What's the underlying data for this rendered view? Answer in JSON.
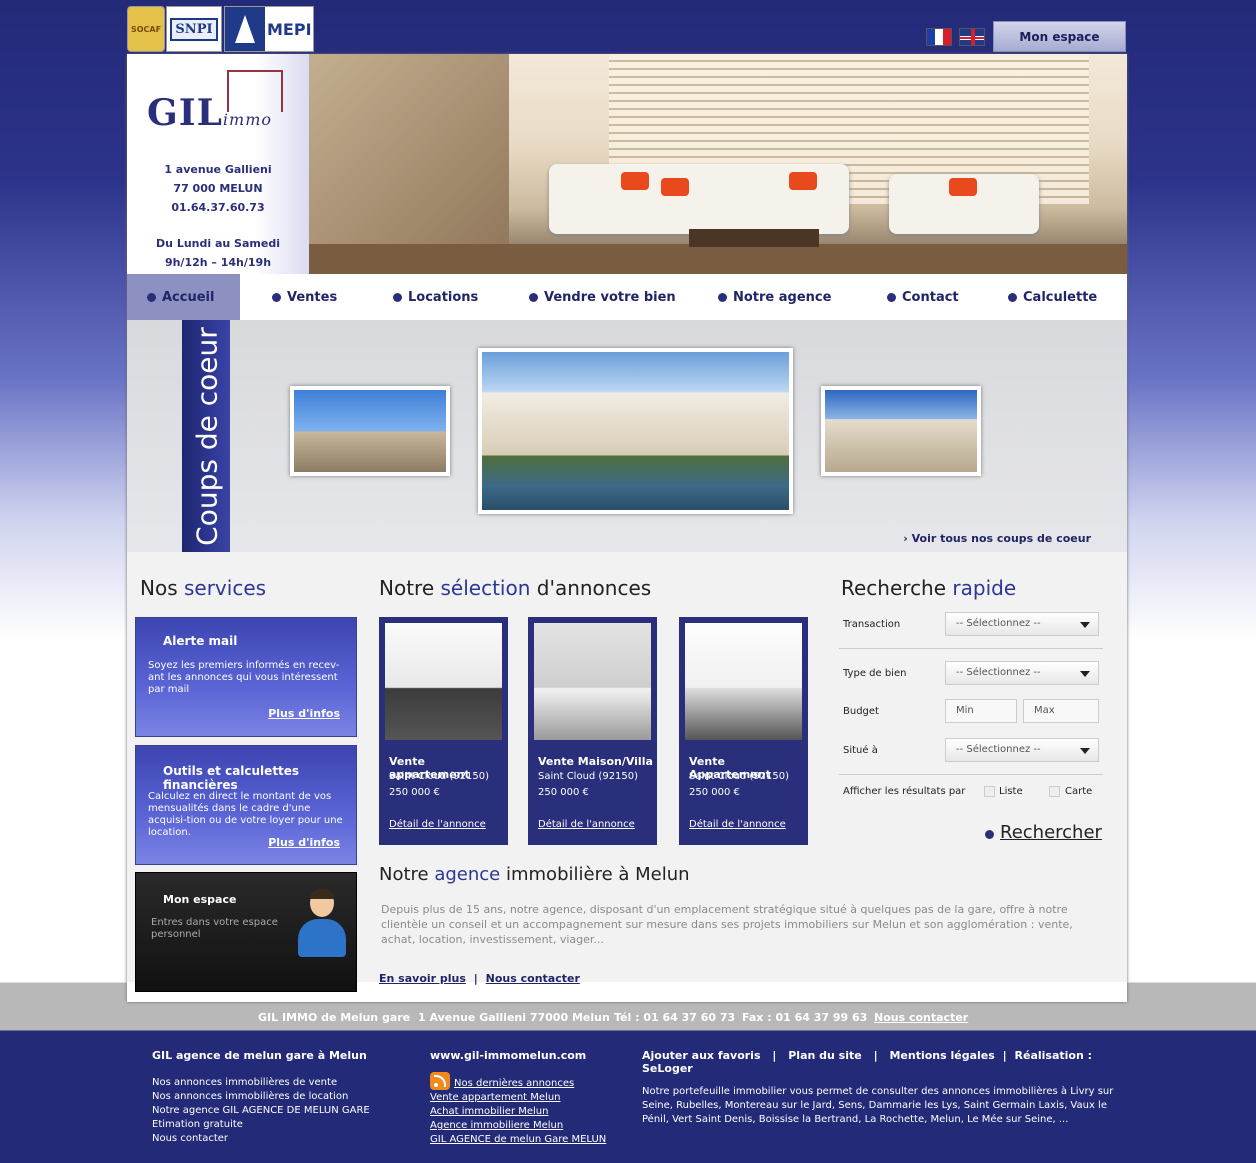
{
  "top": {
    "logos": {
      "socaf": "SOCAF",
      "snpi": "SNPI",
      "amepi": "MEPI"
    },
    "flags": [
      "fr",
      "uk"
    ],
    "mon_espace": "Mon espace"
  },
  "header": {
    "brand": "GIL",
    "brand_sub": "immo",
    "address1": "1 avenue Gallieni",
    "address2": "77 000 MELUN",
    "phone": "01.64.37.60.73",
    "hours1": "Du Lundi au Samedi",
    "hours2": "9h/12h – 14h/19h"
  },
  "nav": {
    "items": [
      {
        "label": "Accueil"
      },
      {
        "label": "Ventes"
      },
      {
        "label": "Locations"
      },
      {
        "label": "Vendre votre bien"
      },
      {
        "label": "Notre agence"
      },
      {
        "label": "Contact"
      },
      {
        "label": "Calculette"
      }
    ]
  },
  "coups": {
    "ribbon": "Coups de coeur",
    "see_all": "› Voir tous nos coups de coeur"
  },
  "services": {
    "title_a": "Nos ",
    "title_b": "services",
    "alert": {
      "title": "Alerte mail",
      "text": "Soyez les premiers informés en recev-ant les annonces qui vous intéressent par mail",
      "more": "Plus d'infos"
    },
    "tools": {
      "title": "Outils et calculettes financières",
      "text": "Calculez en direct le montant de vos mensualités dans le cadre d'une acquisi-tion ou de votre loyer pour une location.",
      "more": "Plus d'infos"
    },
    "espace": {
      "title": "Mon espace",
      "text": "Entres dans votre espace personnel"
    }
  },
  "selection": {
    "title_a": "Notre ",
    "title_b": "sélection",
    "title_c": " d'annonces",
    "cards": [
      {
        "title": "Vente appartement",
        "location": "Saint Cloud  (92150)",
        "price": "250 000 €",
        "link": "Détail de l'annonce"
      },
      {
        "title": "Vente Maison/Villa",
        "location": "Saint Cloud  (92150)",
        "price": "250 000 €",
        "link": "Détail de l'annonce"
      },
      {
        "title": "Vente Appartement",
        "location": "Saint Cloud  (92150)",
        "price": "250 000 €",
        "link": "Détail de l'annonce"
      }
    ]
  },
  "agency": {
    "title_a": "Notre ",
    "title_b": "agence",
    "title_c": " immobilière à Melun",
    "text": "Depuis plus de 15 ans, notre agence, disposant d'un emplacement stratégique situé à quelques pas de la gare, offre à notre clientèle un conseil et un accompagnement sur mesure dans ses projets immobiliers sur Melun et son agglomération : vente, achat, location, investissement, viager...",
    "more": "En savoir plus",
    "sep": "|",
    "contact": "Nous contacter"
  },
  "search": {
    "title_a": "Recherche ",
    "title_b": "rapide",
    "transaction_label": "Transaction",
    "type_label": "Type de bien",
    "budget_label": "Budget",
    "situe_label": "Situé à",
    "select_placeholder": "-- Sélectionnez --",
    "min_placeholder": "Min",
    "max_placeholder": "Max",
    "display_label": "Afficher les résultats par",
    "opt_list": "Liste",
    "opt_map": "Carte",
    "button": "Rechercher"
  },
  "footer_bar": {
    "name": "GIL IMMO de Melun gare",
    "address": "1 Avenue Gallieni 77000 Melun",
    "tel": "Tél : 01 64 37 60 73",
    "fax": "Fax : 01 64 37 99 63",
    "contact": "Nous contacter"
  },
  "footer": {
    "col1": {
      "title": "GIL agence de melun gare à Melun",
      "items": [
        "Nos annonces immobilières de vente",
        "Nos annonces immobilières de location",
        "Notre agence GIL AGENCE DE MELUN GARE",
        "Etimation gratuite",
        "Nous contacter"
      ]
    },
    "col2": {
      "title": "www.gil-immomelun.com",
      "items": [
        "Nos dernières annonces",
        "Vente appartement Melun",
        "Achat immobilier Melun",
        "Agence immobiliere Melun",
        "GIL AGENCE de melun Gare MELUN"
      ]
    },
    "col3": {
      "links": [
        "Ajouter aux favoris",
        "Plan du site",
        "Mentions légales",
        "Réalisation : SeLoger"
      ],
      "sep": "|",
      "text": "Notre portefeuille immobilier vous permet de consulter des annonces immobilières à Livry sur Seine, Rubelles, Montereau sur le Jard, Sens, Dammarie les Lys, Saint Germain Laxis, Vaux le Pénil, Vert Saint Denis, Boissise la Bertrand, La Rochette, Melun, Le Mée sur Seine, ..."
    }
  }
}
